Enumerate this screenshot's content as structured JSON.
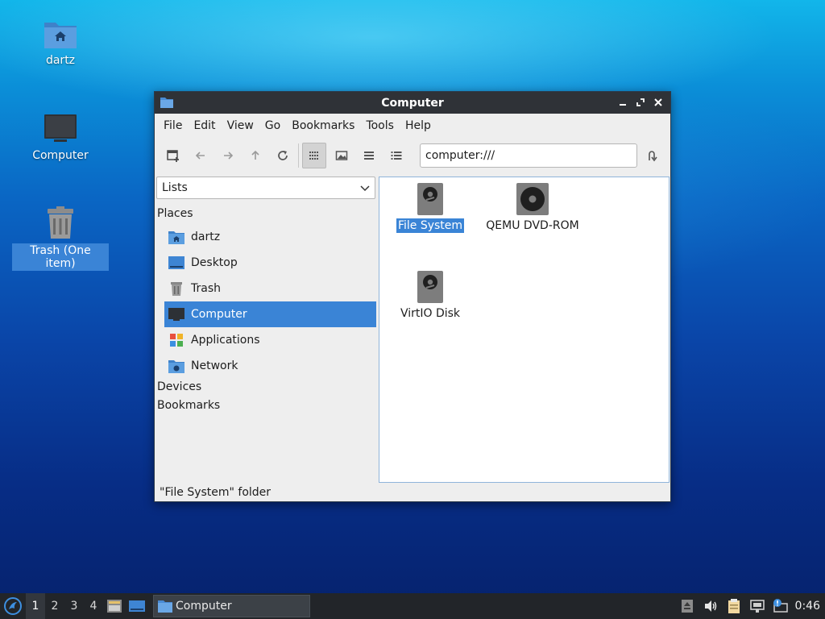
{
  "desktop": {
    "icons": [
      {
        "label": "dartz"
      },
      {
        "label": "Computer"
      },
      {
        "label": "Trash (One item)"
      }
    ]
  },
  "window": {
    "title": "Computer",
    "menu": [
      "File",
      "Edit",
      "View",
      "Go",
      "Bookmarks",
      "Tools",
      "Help"
    ],
    "address": "computer:///",
    "sidepane": {
      "mode": "Lists",
      "places_header": "Places",
      "places": [
        {
          "label": "dartz",
          "icon": "home-folder-icon"
        },
        {
          "label": "Desktop",
          "icon": "desktop-icon"
        },
        {
          "label": "Trash",
          "icon": "trash-icon"
        },
        {
          "label": "Computer",
          "icon": "computer-icon",
          "selected": true
        },
        {
          "label": "Applications",
          "icon": "applications-icon"
        },
        {
          "label": "Network",
          "icon": "network-folder-icon"
        }
      ],
      "devices_header": "Devices",
      "bookmarks_header": "Bookmarks"
    },
    "items": [
      {
        "label": "File System",
        "icon": "harddisk-icon",
        "selected": true
      },
      {
        "label": "QEMU DVD-ROM",
        "icon": "optical-drive-icon"
      },
      {
        "label": "VirtIO Disk",
        "icon": "harddisk-icon"
      }
    ],
    "status": "\"File System\" folder"
  },
  "taskbar": {
    "workspaces": [
      "1",
      "2",
      "3",
      "4"
    ],
    "active_workspace": "1",
    "task_label": "Computer",
    "clock": "0:46"
  },
  "colors": {
    "selection": "#3a84d6",
    "titlebar": "#2f3237",
    "taskbar": "#222529"
  }
}
